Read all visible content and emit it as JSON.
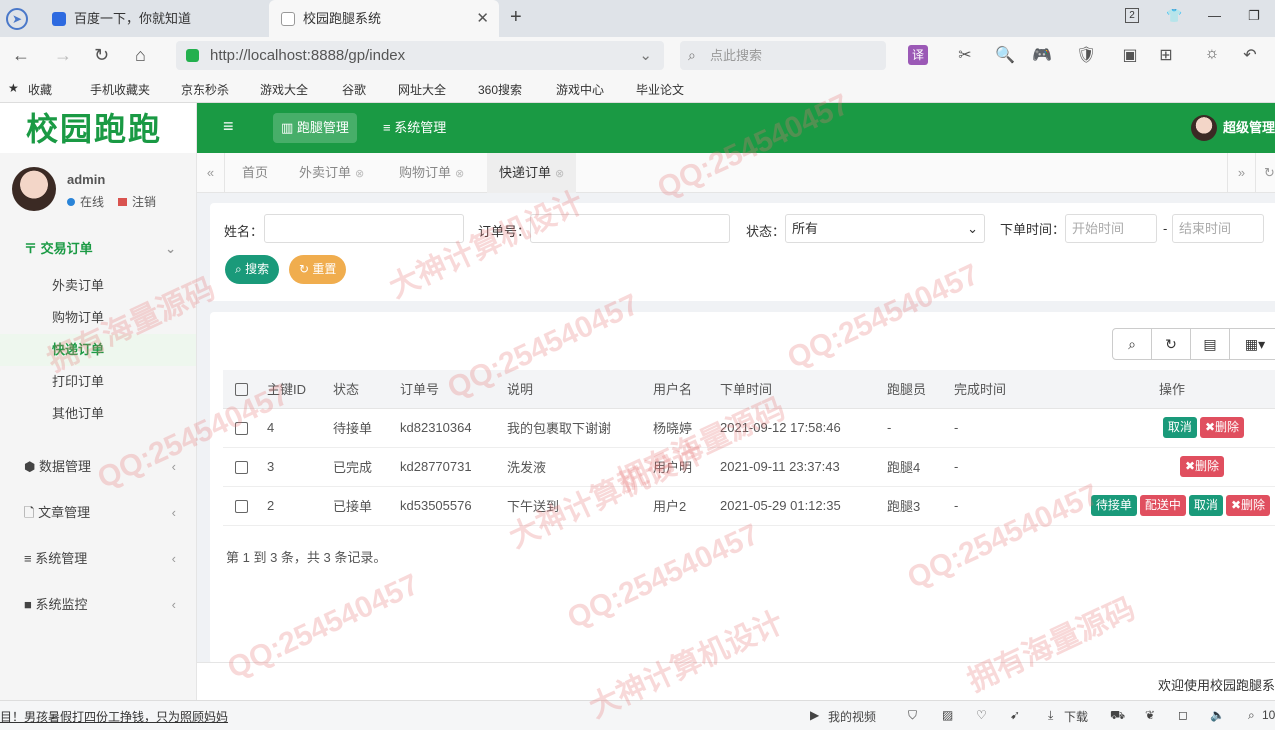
{
  "browser": {
    "tabs": [
      {
        "title": "百度一下，你就知道"
      },
      {
        "title": "校园跑腿系统"
      }
    ],
    "url": "http://localhost:8888/gp/index",
    "search_placeholder": "点此搜索",
    "tab_count_badge": "2",
    "bookmarks": [
      "收藏",
      "手机收藏夹",
      "京东秒杀",
      "游戏大全",
      "谷歌",
      "网址大全",
      "360搜索",
      "游戏中心",
      "毕业论文"
    ],
    "status": {
      "news": "目！男孩暑假打四份工挣钱，只为照顾妈妈",
      "video": "我的视频",
      "download": "下载",
      "zoom": "10"
    }
  },
  "app": {
    "logo": "校园跑跑",
    "user": {
      "name": "admin",
      "online": "在线",
      "logout": "注销"
    },
    "top_nav": [
      {
        "label": "跑腿管理",
        "icon": "bar-chart-icon"
      },
      {
        "label": "系统管理",
        "icon": "menu-icon"
      }
    ],
    "admin_label": "超级管理",
    "sidebar": {
      "trade_group": "交易订单",
      "trade_items": [
        "外卖订单",
        "购物订单",
        "快递订单",
        "打印订单",
        "其他订单"
      ],
      "other_groups": [
        "数据管理",
        "文章管理",
        "系统管理",
        "系统监控"
      ]
    },
    "page_tabs": [
      "首页",
      "外卖订单",
      "购物订单",
      "快递订单"
    ],
    "filters": {
      "name_label": "姓名：",
      "order_label": "订单号：",
      "status_label": "状态：",
      "status_value": "所有",
      "time_label": "下单时间：",
      "start_placeholder": "开始时间",
      "end_placeholder": "结束时间",
      "dash": "-",
      "search_btn": "搜索",
      "reset_btn": "重置"
    },
    "table": {
      "headers": [
        "主键ID",
        "状态",
        "订单号",
        "说明",
        "用户名",
        "下单时间",
        "跑腿员",
        "完成时间",
        "操作"
      ],
      "rows": [
        {
          "id": "4",
          "status": "待接单",
          "order": "kd82310364",
          "desc": "我的包裹取下谢谢",
          "user": "杨晓婷",
          "time": "2021-09-12 17:58:46",
          "runner": "-",
          "done": "-"
        },
        {
          "id": "3",
          "status": "已完成",
          "order": "kd28770731",
          "desc": "洗发液",
          "user": "用户明",
          "time": "2021-09-11 23:37:43",
          "runner": "跑腿4",
          "done": "-"
        },
        {
          "id": "2",
          "status": "已接单",
          "order": "kd53505576",
          "desc": "下午送到",
          "user": "用户2",
          "time": "2021-05-29 01:12:35",
          "runner": "跑腿3",
          "done": "-"
        }
      ],
      "ops": {
        "cancel": "取消",
        "delete": "✖删除",
        "pending": "待接单",
        "delivering": "配送中"
      }
    },
    "pagination": "第 1 到 3 条，共 3 条记录。",
    "footer": "欢迎使用校园跑腿系",
    "watermarks": [
      "QQ:254540457",
      "拥有海量源码",
      "大神计算机设计"
    ]
  }
}
